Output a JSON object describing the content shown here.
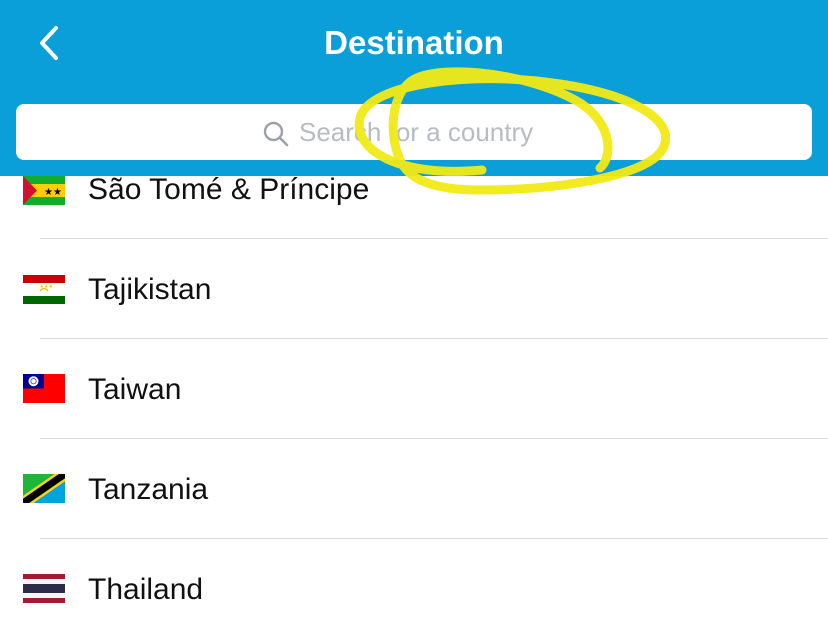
{
  "header": {
    "title": "Destination",
    "back_icon": "chevron-left-icon",
    "background_color": "#0a9fd8"
  },
  "search": {
    "placeholder": "Search for a country",
    "value": "",
    "icon": "search-icon"
  },
  "countries": [
    {
      "name": "São Tomé & Príncipe",
      "flag": "sao-tome-and-principe-flag-icon"
    },
    {
      "name": "Tajikistan",
      "flag": "tajikistan-flag-icon"
    },
    {
      "name": "Taiwan",
      "flag": "taiwan-flag-icon"
    },
    {
      "name": "Tanzania",
      "flag": "tanzania-flag-icon"
    },
    {
      "name": "Thailand",
      "flag": "thailand-flag-icon"
    }
  ],
  "annotation": {
    "type": "hand-drawn-circle",
    "color": "#f2ea16",
    "target": "search-input"
  }
}
